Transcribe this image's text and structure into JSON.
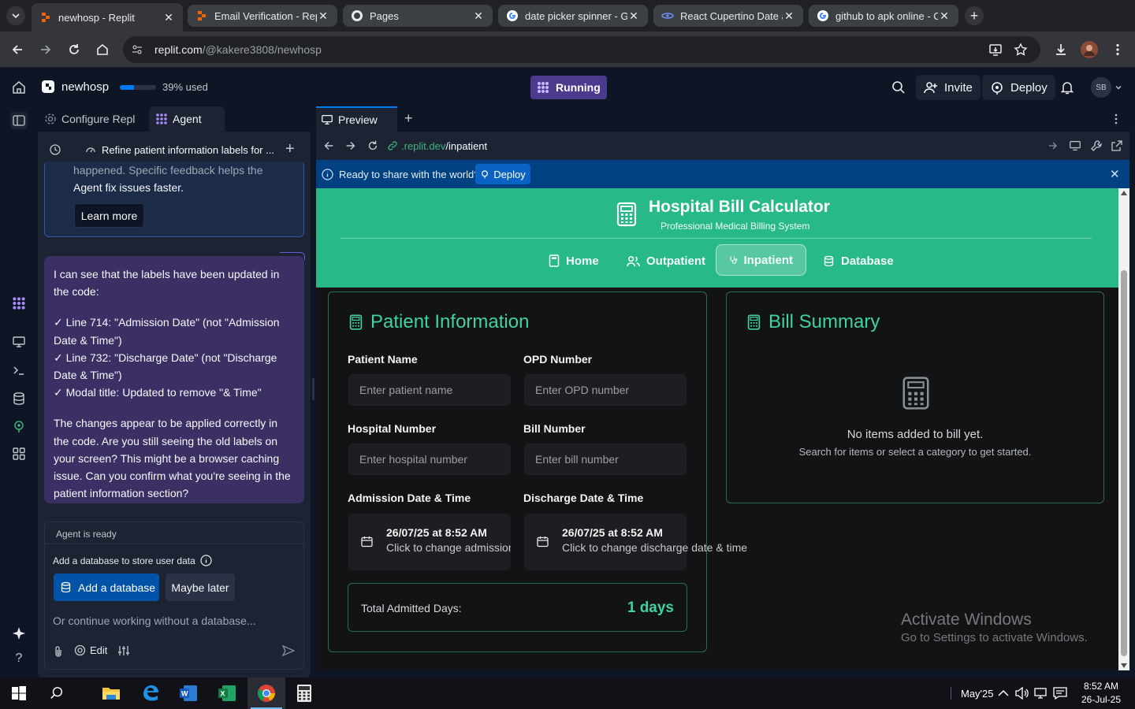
{
  "browser": {
    "tabs": [
      {
        "title": "newhosp - Replit",
        "active": true
      },
      {
        "title": "Email Verification - Repl",
        "active": false
      },
      {
        "title": "Pages",
        "active": false
      },
      {
        "title": "date picker spinner - Go",
        "active": false
      },
      {
        "title": "React Cupertino Date an",
        "active": false
      },
      {
        "title": "github to apk online - C",
        "active": false
      }
    ],
    "url_host": "replit.com",
    "url_path": "/@kakere3808/newhosp"
  },
  "replit_top": {
    "project_name": "newhosp",
    "usage_text": "39% used",
    "usage_percent": 39,
    "run_status": "Running",
    "invite_label": "Invite",
    "deploy_label": "Deploy",
    "avatar_initials": "SB"
  },
  "agent_panel": {
    "tabs": [
      "Configure Repl",
      "Agent"
    ],
    "thread_title": "Refine patient information labels for ...",
    "feedback_text_partial": "happened. Specific feedback helps the",
    "feedback_text_end": "Agent fix issues faster.",
    "learn_more_label": "Learn more",
    "message_paragraphs": [
      "I can see that the labels have been updated in the code:",
      "✓ Line 714: \"Admission Date\" (not \"Admission Date & Time\")\n✓ Line 732: \"Discharge Date\" (not \"Discharge Date & Time\")\n✓ Modal title: Updated to remove \"& Time\"",
      "The changes appear to be applied correctly in the code. Are you still seeing the old labels on your screen? This might be a browser caching issue. Can you confirm what you're seeing in the patient information section?"
    ],
    "status_label": "Agent is ready",
    "db_prompt": "Add a database to store user data",
    "add_db_label": "Add a database",
    "maybe_later_label": "Maybe later",
    "input_placeholder": "Or continue working without a database...",
    "edit_label": "Edit"
  },
  "preview": {
    "tab_label": "Preview",
    "url_host": ".replit.dev",
    "url_path": "/inpatient",
    "banner_text": "Ready to share with the world?",
    "banner_button": "Deploy"
  },
  "app": {
    "title": "Hospital Bill Calculator",
    "subtitle": "Professional Medical Billing System",
    "nav": [
      "Home",
      "Outpatient",
      "Inpatient",
      "Database"
    ],
    "nav_selected": "Inpatient",
    "patient_section_title": "Patient Information",
    "fields": {
      "patient_name_label": "Patient Name",
      "patient_name_placeholder": "Enter patient name",
      "opd_label": "OPD Number",
      "opd_placeholder": "Enter OPD number",
      "hospital_label": "Hospital Number",
      "hospital_placeholder": "Enter hospital number",
      "bill_label": "Bill Number",
      "bill_placeholder": "Enter bill number",
      "admission_label": "Admission Date & Time",
      "admission_value": "26/07/25 at 8:52 AM",
      "admission_hint": "Click to change admission date & time",
      "discharge_label": "Discharge Date & Time",
      "discharge_value": "26/07/25 at 8:52 AM",
      "discharge_hint": "Click to change discharge date & time"
    },
    "total_days_label": "Total Admitted Days:",
    "total_days_value": "1 days",
    "bill_section_title": "Bill Summary",
    "bill_empty_title": "No items added to bill yet.",
    "bill_empty_sub": "Search for items or select a category to get started.",
    "accent_color": "#28b989"
  },
  "watermark": {
    "line1": "Activate Windows",
    "line2": "Go to Settings to activate Windows."
  },
  "taskbar": {
    "tray_label": "May'25",
    "time": "8:52 AM",
    "date": "26-Jul-25"
  }
}
